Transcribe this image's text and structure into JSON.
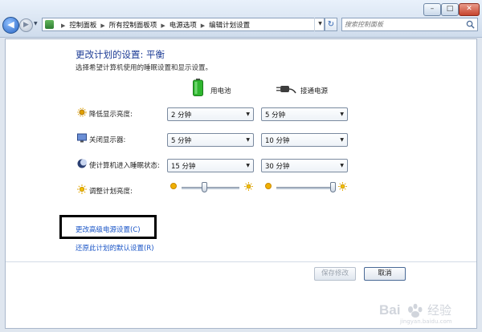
{
  "window": {
    "minimize_glyph": "–",
    "maximize_glyph": "□",
    "close_glyph": "✕"
  },
  "nav": {
    "back_glyph": "◀",
    "forward_glyph": "▶",
    "recent_glyph": "▼",
    "refresh_glyph": "↻",
    "dropdown_glyph": "▼"
  },
  "address": {
    "icon": "control-panel-icon",
    "breadcrumb": [
      "控制面板",
      "所有控制面板项",
      "电源选项",
      "编辑计划设置"
    ],
    "separator": "▶"
  },
  "search": {
    "placeholder": "搜索控制面板"
  },
  "main": {
    "heading": "更改计划的设置: 平衡",
    "subheading": "选择希望计算机使用的睡眠设置和显示设置。",
    "columns": {
      "battery": "用电池",
      "plugged": "接通电源"
    },
    "rows": [
      {
        "label": "降低显示亮度:",
        "icon": "dim-display-icon",
        "battery": "2 分钟",
        "plugged": "5 分钟"
      },
      {
        "label": "关闭显示器:",
        "icon": "monitor-icon",
        "battery": "5 分钟",
        "plugged": "10 分钟"
      },
      {
        "label": "使计算机进入睡眠状态:",
        "icon": "sleep-moon-icon",
        "battery": "15 分钟",
        "plugged": "30 分钟"
      }
    ],
    "brightness": {
      "label": "调整计划亮度:",
      "icon": "brightness-sun-icon",
      "battery_level": 0.4,
      "plugged_level": 0.98
    },
    "links": {
      "advanced": "更改高级电源设置(C)",
      "restore": "还原此计划的默认设置(R)"
    },
    "buttons": {
      "save": "保存修改",
      "cancel": "取消"
    },
    "dropdown_arrow": "▼"
  },
  "watermark": {
    "text": "Bai 经验",
    "sub": "jingyan.baidu.com"
  },
  "colors": {
    "heading": "#1e3d96",
    "link": "#1a55c7",
    "highlight_border": "#000000",
    "battery_green": "#2fb62f"
  }
}
